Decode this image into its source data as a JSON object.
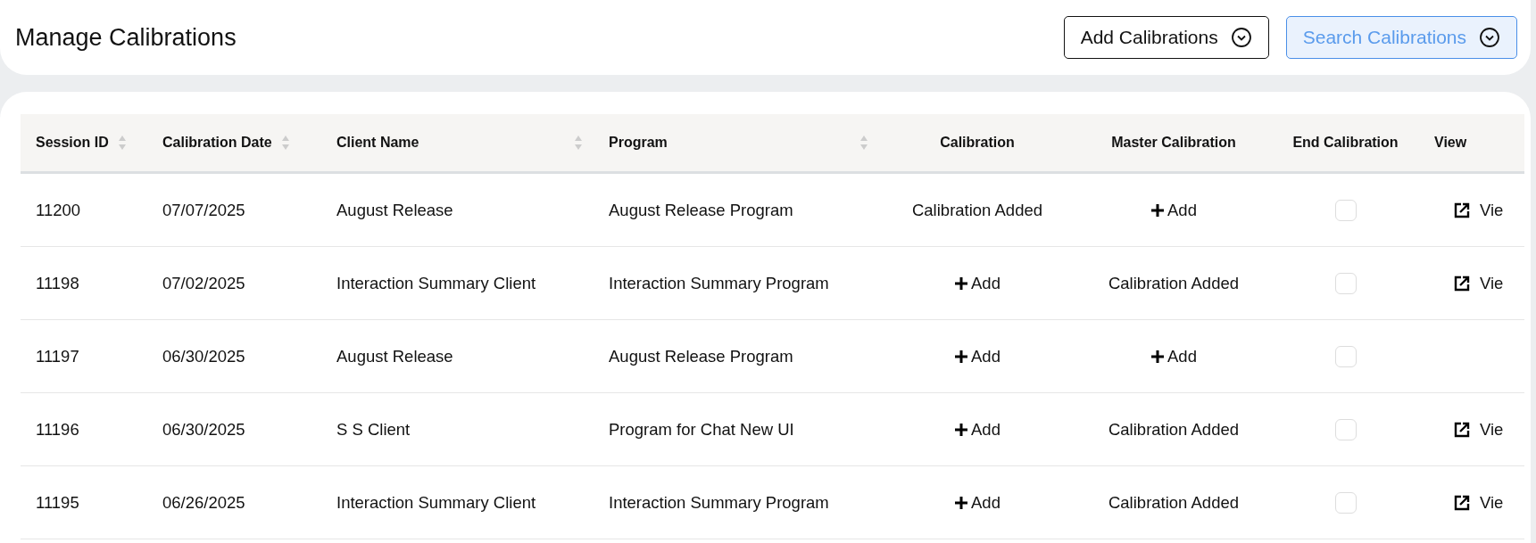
{
  "page": {
    "title": "Manage Calibrations"
  },
  "actions": [
    {
      "label": "Add Calibrations",
      "selected": false
    },
    {
      "label": "Search Calibrations",
      "selected": true
    }
  ],
  "table": {
    "columns": [
      {
        "label": "Session ID",
        "sortable": true
      },
      {
        "label": "Calibration Date",
        "sortable": true
      },
      {
        "label": "Client Name",
        "sortable": true
      },
      {
        "label": "Program",
        "sortable": true
      },
      {
        "label": "Calibration",
        "sortable": false
      },
      {
        "label": "Master Calibration",
        "sortable": false
      },
      {
        "label": "End Calibration",
        "sortable": false
      },
      {
        "label": "View",
        "sortable": false
      }
    ],
    "rows": [
      {
        "session_id": "11200",
        "date": "07/07/2025",
        "client": "August Release",
        "program": "August Release Program",
        "calibration": {
          "kind": "status",
          "text": "Calibration Added"
        },
        "master": {
          "kind": "add",
          "text": "Add"
        },
        "ended": false,
        "view": "Vie"
      },
      {
        "session_id": "11198",
        "date": "07/02/2025",
        "client": "Interaction Summary Client",
        "program": "Interaction Summary Program",
        "calibration": {
          "kind": "add",
          "text": "Add"
        },
        "master": {
          "kind": "status",
          "text": "Calibration Added"
        },
        "ended": false,
        "view": "Vie"
      },
      {
        "session_id": "11197",
        "date": "06/30/2025",
        "client": "August Release",
        "program": "August Release Program",
        "calibration": {
          "kind": "add",
          "text": "Add"
        },
        "master": {
          "kind": "add",
          "text": "Add"
        },
        "ended": false
      },
      {
        "session_id": "11196",
        "date": "06/30/2025",
        "client": "S S Client",
        "program": "Program for Chat New UI",
        "calibration": {
          "kind": "add",
          "text": "Add"
        },
        "master": {
          "kind": "status",
          "text": "Calibration Added"
        },
        "ended": false,
        "view": "Vie"
      },
      {
        "session_id": "11195",
        "date": "06/26/2025",
        "client": "Interaction Summary Client",
        "program": "Interaction Summary Program",
        "calibration": {
          "kind": "add",
          "text": "Add"
        },
        "master": {
          "kind": "status",
          "text": "Calibration Added"
        },
        "ended": false,
        "view": "Vie"
      }
    ]
  }
}
